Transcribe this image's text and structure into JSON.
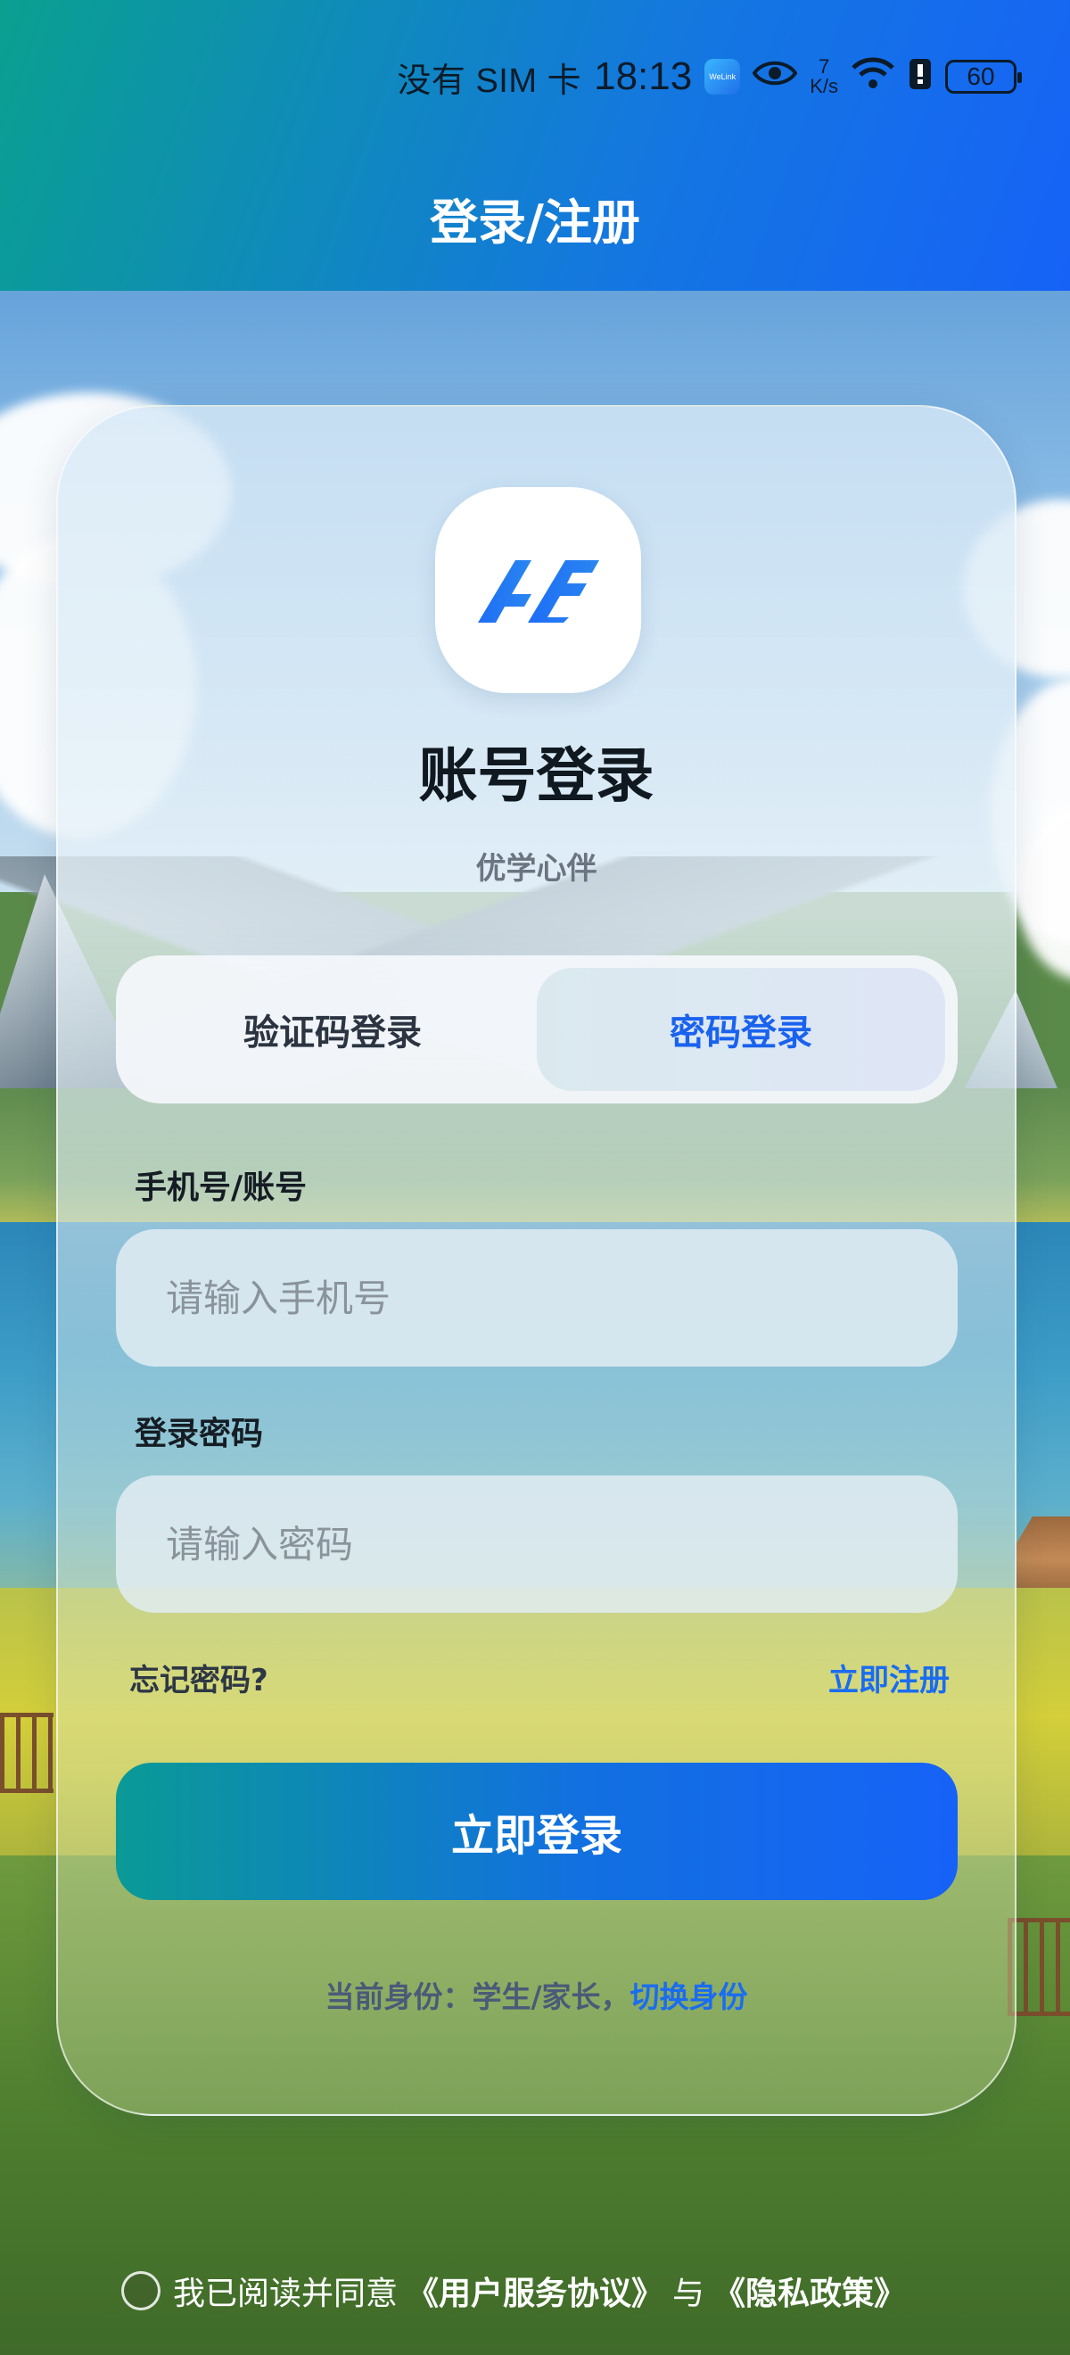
{
  "status_bar": {
    "carrier": "没有 SIM 卡",
    "time": "18:13",
    "app_badge": "WeLink",
    "net_speed_value": "7",
    "net_speed_unit": "K/s",
    "battery": "60"
  },
  "header": {
    "title": "登录/注册"
  },
  "card": {
    "title": "账号登录",
    "subtitle": "优学心伴",
    "tabs": [
      {
        "label": "验证码登录",
        "active": false
      },
      {
        "label": "密码登录",
        "active": true
      }
    ],
    "phone_label": "手机号/账号",
    "phone_placeholder": "请输入手机号",
    "password_label": "登录密码",
    "password_placeholder": "请输入密码",
    "forgot": "忘记密码?",
    "register": "立即注册",
    "login_button": "立即登录",
    "identity_prefix": "当前身份：学生/家长，",
    "identity_switch": "切换身份"
  },
  "agreement": {
    "prefix": "我已阅读并同意",
    "user_agreement": "《用户服务协议》",
    "joiner": "与",
    "privacy_policy": "《隐私政策》"
  },
  "colors": {
    "accent": "#1a62ee",
    "header_gradient_start": "#0aa090",
    "header_gradient_end": "#1662f7"
  }
}
